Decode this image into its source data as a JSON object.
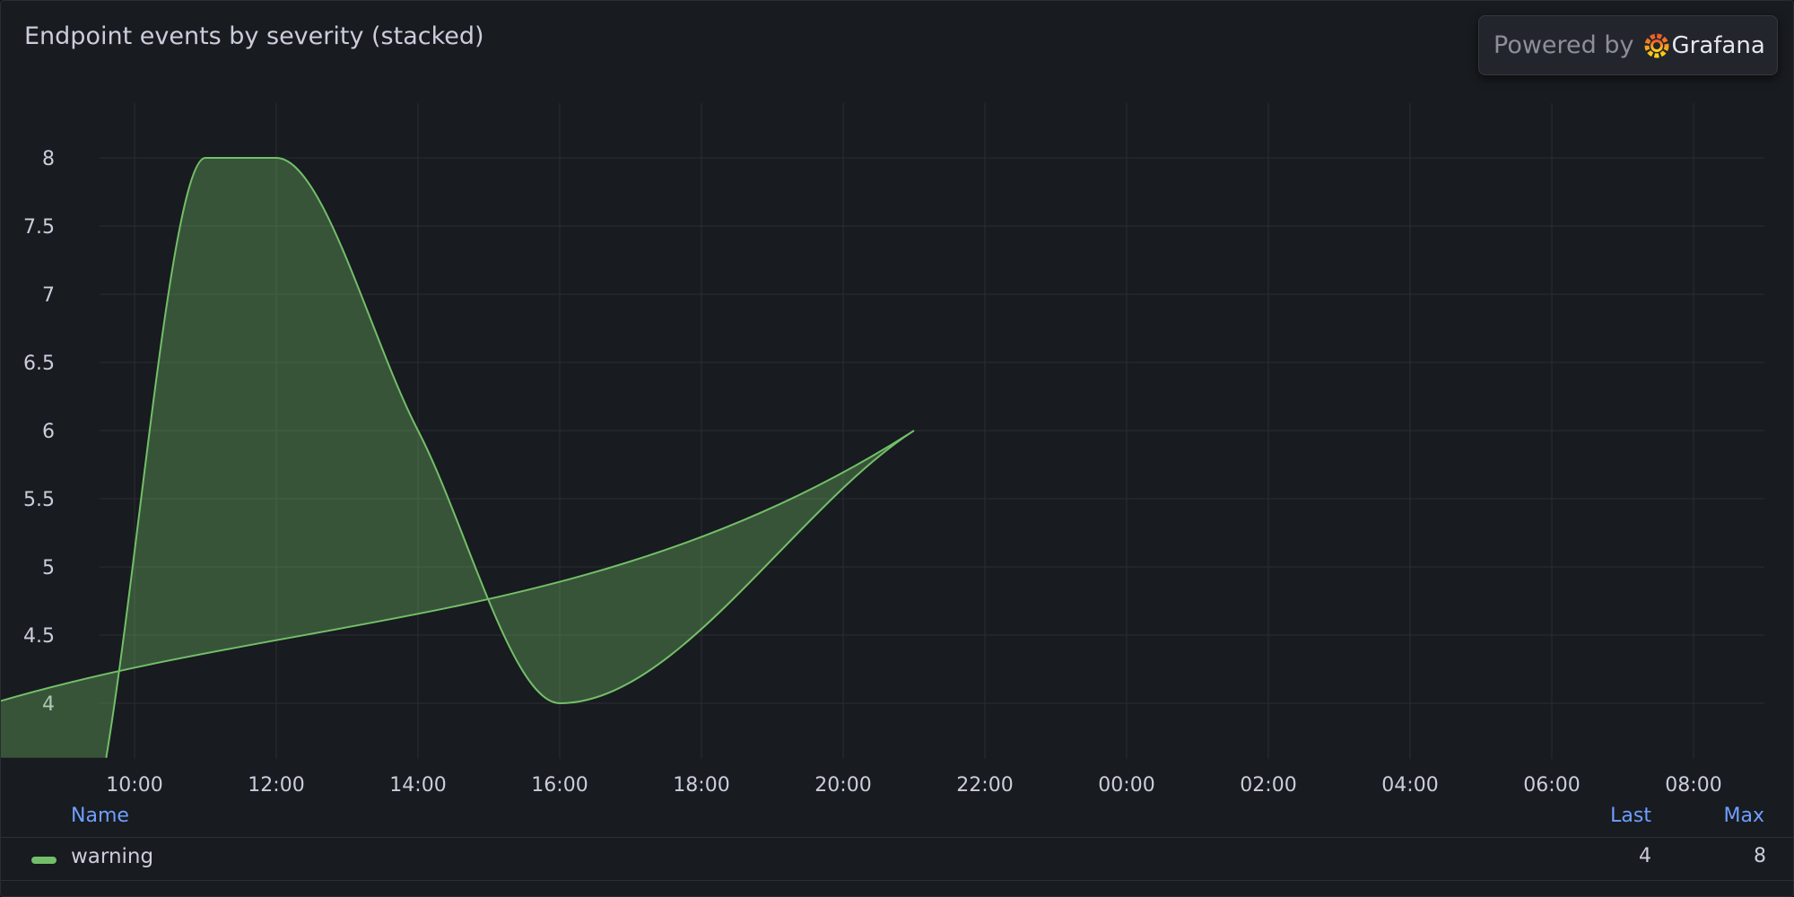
{
  "panel": {
    "title": "Endpoint events by severity (stacked)"
  },
  "badge": {
    "powered_by": "Powered by",
    "brand": "Grafana",
    "logo_icon": "grafana-logo-icon"
  },
  "colors": {
    "series": "#73bf69",
    "fill": "#324d35",
    "link": "#6e9fff"
  },
  "legend": {
    "columns": {
      "name": "Name",
      "last": "Last",
      "max": "Max"
    },
    "rows": [
      {
        "name": "warning",
        "last": "4",
        "max": "8"
      }
    ]
  },
  "chart_data": {
    "type": "area",
    "title": "Endpoint events by severity (stacked)",
    "xlabel": "",
    "ylabel": "",
    "stacked": true,
    "grid": true,
    "legend_placement": "bottom",
    "x_ticks": [
      "10:00",
      "12:00",
      "14:00",
      "16:00",
      "18:00",
      "20:00",
      "22:00",
      "00:00",
      "02:00",
      "04:00",
      "06:00",
      "08:00"
    ],
    "y_ticks": [
      "4",
      "4.5",
      "5",
      "5.5",
      "6",
      "6.5",
      "7",
      "7.5",
      "8"
    ],
    "ylim": [
      3.6,
      8.4
    ],
    "x_range_hours": [
      -0.4,
      22.3
    ],
    "series": [
      {
        "name": "warning",
        "points": [
          {
            "t": "09:36",
            "v": 3.6
          },
          {
            "t": "11:00",
            "v": 8
          },
          {
            "t": "12:00",
            "v": 8
          },
          {
            "t": "14:00",
            "v": 6
          },
          {
            "t": "16:00",
            "v": 4
          },
          {
            "t": "21:00",
            "v": 6
          },
          {
            "t": "08:00",
            "v": 4
          }
        ]
      }
    ]
  }
}
